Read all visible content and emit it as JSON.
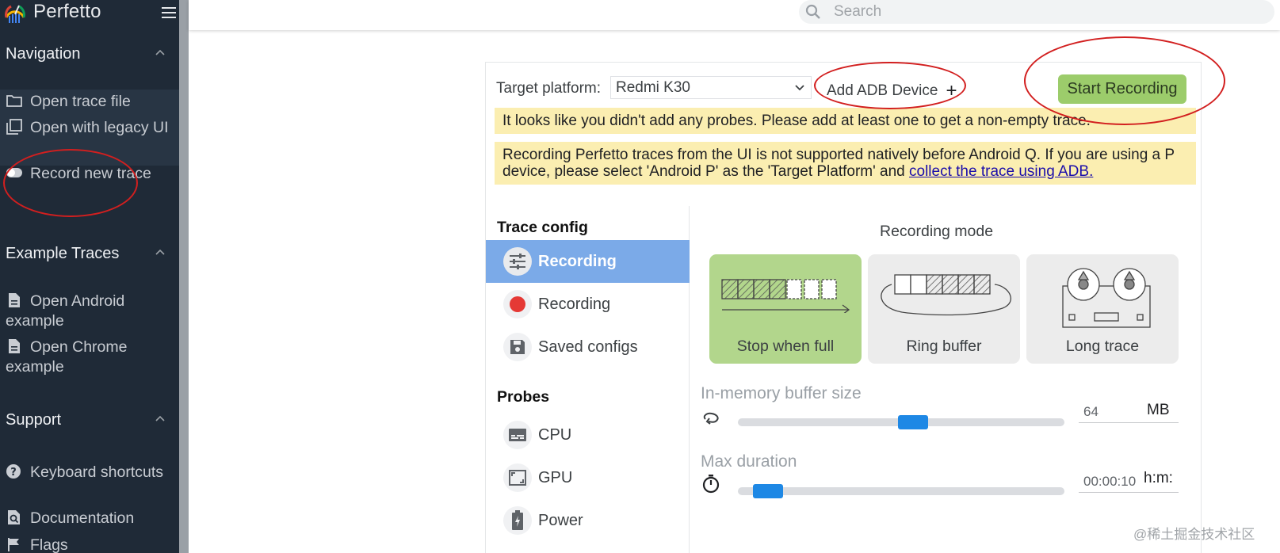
{
  "app": {
    "title": "Perfetto"
  },
  "search": {
    "placeholder": "Search"
  },
  "sidebar": {
    "navigation": {
      "title": "Navigation",
      "items": [
        {
          "label": "Open trace file",
          "icon": "folder-icon"
        },
        {
          "label": "Open with legacy UI",
          "icon": "copy-icon"
        },
        {
          "label": "Record new trace",
          "icon": "toggle-icon"
        }
      ]
    },
    "examples": {
      "title": "Example Traces",
      "items": [
        {
          "label": "Open Android example",
          "icon": "file-icon"
        },
        {
          "label": "Open Chrome example",
          "icon": "file-icon"
        }
      ]
    },
    "support": {
      "title": "Support",
      "items": [
        {
          "label": "Keyboard shortcuts",
          "icon": "help-icon"
        },
        {
          "label": "Documentation",
          "icon": "doc-search-icon"
        },
        {
          "label": "Flags",
          "icon": "flag-icon"
        }
      ]
    }
  },
  "record": {
    "target_label": "Target platform:",
    "target_value": "Redmi K30",
    "add_adb": "Add ADB Device",
    "add_plus": "+",
    "start_button": "Start Recording",
    "warning_probes": "It looks like you didn't add any probes. Please add at least one to get a non-empty trace.",
    "warning_android_text": "Recording Perfetto traces from the UI is not supported natively before Android Q. If you are using a P device, please select 'Android P' as the 'Target Platform' and",
    "warning_android_link": "collect the trace using ADB.",
    "trace_config_title": "Trace config",
    "trace_config_items": [
      {
        "label": "Recording",
        "icon": "sliders-icon",
        "active": true
      },
      {
        "label": "Recording",
        "icon": "record-dot-icon",
        "active": false
      },
      {
        "label": "Saved configs",
        "icon": "save-icon",
        "active": false
      }
    ],
    "probes_title": "Probes",
    "probe_items": [
      {
        "label": "CPU",
        "icon": "cpu-icon"
      },
      {
        "label": "GPU",
        "icon": "gpu-icon"
      },
      {
        "label": "Power",
        "icon": "battery-icon"
      }
    ],
    "mode_title": "Recording mode",
    "modes": [
      {
        "label": "Stop when full",
        "icon": "stop-when-full-icon",
        "selected": true
      },
      {
        "label": "Ring buffer",
        "icon": "ring-buffer-icon",
        "selected": false
      },
      {
        "label": "Long trace",
        "icon": "tape-reel-icon",
        "selected": false
      }
    ],
    "buffer": {
      "label": "In-memory buffer size",
      "value": "64",
      "unit": "MB",
      "level": 0.54
    },
    "duration": {
      "label": "Max duration",
      "value": "00:00:10",
      "unit": "h:m:",
      "level": 0.05
    }
  },
  "watermark": "@稀土掘金技术社区",
  "colors": {
    "sidebar_bg": "#1f2a37",
    "accent_green": "#9ccc6b",
    "active_blue": "#7baae8",
    "warning_bg": "#fbeeb1",
    "slider_blue": "#1e88e5",
    "annotation_red": "#d21f1f"
  }
}
